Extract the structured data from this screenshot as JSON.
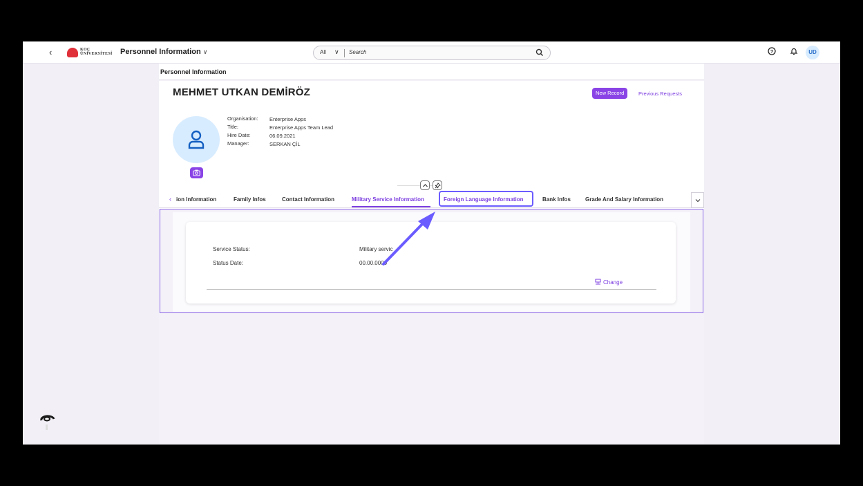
{
  "shell": {
    "back": "‹",
    "logo_line1": "KOÇ",
    "logo_line2": "ÜNİVERSİTESİ",
    "app_title": "Personnel Information",
    "app_title_chevron": "∨",
    "search_scope": "All",
    "search_scope_chevron": "∨",
    "search_placeholder": "Search",
    "user_initials": "UD",
    "icons": [
      "back-icon",
      "search-icon",
      "help-icon",
      "bell-icon"
    ]
  },
  "breadcrumb": "Personnel Information",
  "employee": {
    "name": "MEHMET UTKAN DEMİRÖZ",
    "new_record": "New Record",
    "previous_requests": "Previous Requests",
    "fields": [
      {
        "label": "Organisation:",
        "value": "Enterprise Apps"
      },
      {
        "label": "Title:",
        "value": "Enterprise Apps Team Lead"
      },
      {
        "label": "Hire Date:",
        "value": "06.09.2021"
      },
      {
        "label": "Manager:",
        "value": "SERKAN ÇİL"
      }
    ]
  },
  "tabs": [
    {
      "label": "ion Information"
    },
    {
      "label": "Family Infos"
    },
    {
      "label": "Contact Information"
    },
    {
      "label": "Military Service Information",
      "active": true
    },
    {
      "label": "Foreign Language Information",
      "highlighted": true
    },
    {
      "label": "Bank Infos"
    },
    {
      "label": "Grade And Salary Information"
    }
  ],
  "military": {
    "fields": [
      {
        "label": "Service Status:",
        "value": "Military servic"
      },
      {
        "label": "Status Date:",
        "value": "00.00.0000"
      }
    ],
    "change": "Change"
  },
  "colors": {
    "accent": "#7d3fe0",
    "button": "#8a44e6",
    "annotation": "#6b5cff"
  }
}
